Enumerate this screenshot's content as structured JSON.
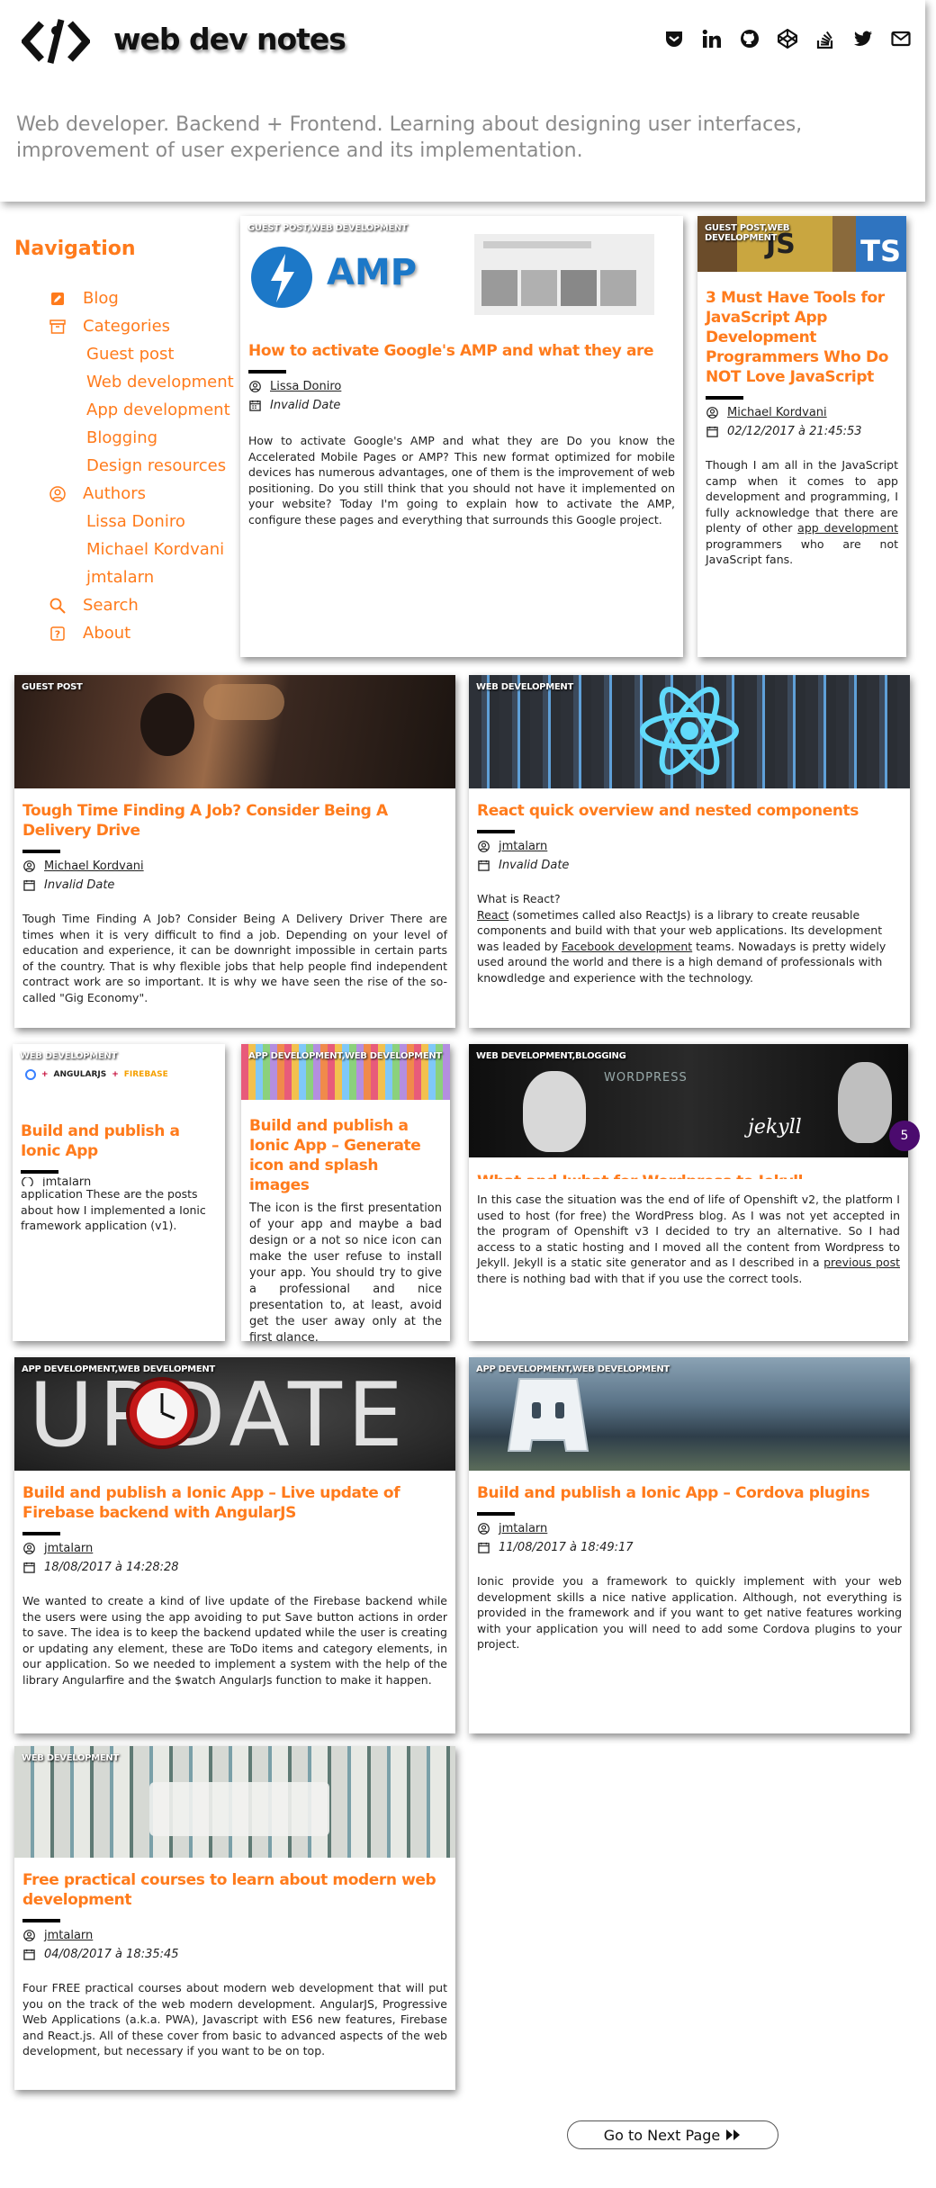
{
  "header": {
    "title": "web dev notes",
    "tagline": "Web developer. Backend + Frontend. Learning about designing user interfaces, improvement of user experience and its implementation.",
    "social": [
      "pocket-icon",
      "linkedin-icon",
      "github-icon",
      "codepen-icon",
      "stackoverflow-icon",
      "twitter-icon",
      "mail-icon"
    ]
  },
  "nav": {
    "title": "Navigation",
    "blog": "Blog",
    "categories": "Categories",
    "category_items": [
      "Guest post",
      "Web development",
      "App development",
      "Blogging",
      "Design resources"
    ],
    "authors": "Authors",
    "author_items": [
      "Lissa Doniro",
      "Michael Kordvani",
      "jmtalarn"
    ],
    "search": "Search",
    "about": "About"
  },
  "posts": [
    {
      "category": "GUEST POST,WEB DEVELOPMENT",
      "title": "How to activate Google's AMP and what they are",
      "author": "Lissa Doniro",
      "date": "Invalid Date",
      "excerpt": "How to activate Google's AMP and what they are Do you know the Accelerated Mobile Pages or AMP? This new format optimized for mobile devices has numerous advantages, one of them is the improvement of web positioning. Do you still think that you should not have it implemented on your website? Today I'm going to explain how to activate the AMP, configure these pages and everything that surrounds this Google project.",
      "thumb_text": "AMP"
    },
    {
      "category": "GUEST POST,WEB DEVELOPMENT",
      "title": "3 Must Have Tools for JavaScript App Development Programmers Who Do NOT Love JavaScript",
      "author": "Michael Kordvani",
      "date": "02/12/2017 à 21:45:53",
      "excerpt_a": "Though I am all in the JavaScript camp when it comes to app development and programming, I fully acknowledge that there are plenty of other ",
      "excerpt_link": "app development",
      "excerpt_b": " programmers who are not JavaScript fans.",
      "thumb_js": "JS",
      "thumb_ts": "TS"
    },
    {
      "category": "GUEST POST",
      "title": "Tough Time Finding A Job? Consider Being A Delivery Drive",
      "author": "Michael Kordvani",
      "date": "Invalid Date",
      "excerpt": "Tough Time Finding A Job? Consider Being A Delivery Driver There are times when it is very difficult to find a job. Depending on your level of education and experience, it can be downright impossible in certain parts of the country. That is why flexible jobs that help people find independent contract work are so important. It is why we have seen the rise of the so-called \"Gig Economy\"."
    },
    {
      "category": "WEB DEVELOPMENT",
      "title": "React quick overview and nested components",
      "author": "jmtalarn",
      "date": "Invalid Date",
      "excerpt_q": "What is React?",
      "excerpt_link1": "React",
      "excerpt_a": " (sometimes called also ReactJs) is a library to create reusable components and build with that your web applications. Its development was leaded by ",
      "excerpt_link2": "Facebook development",
      "excerpt_b": " teams. Nowadays is pretty widely used around the world and there is a high demand of professionals with knowdledge and experience with the technology."
    },
    {
      "category": "WEB DEVELOPMENT",
      "title": "Build and publish a Ionic App",
      "author": "jmtalarn",
      "excerpt": "application These are the posts about how I implemented a Ionic framework application (v1).",
      "thumb_labels": [
        "ANGULARJS",
        "FIREBASE"
      ]
    },
    {
      "category": "APP DEVELOPMENT,WEB DEVELOPMENT",
      "title": "Build and publish a Ionic App – Generate icon and splash images",
      "excerpt": "The icon is the first presentation of your app and maybe a bad design or a not so nice icon can make the user refuse to install your app. You should try to give a professional and nice presentation to, at least, avoid get the user away only at the first glance."
    },
    {
      "category": "WEB DEVELOPMENT,BLOGGING",
      "title": "What and Iwhat for Wordpress to Jekyll",
      "excerpt_a": "In this case the situation was the end of life of Openshift v2, the platform I used to host (for free) the WordPress blog. As I was not yet accepted in the program of Openshift v3 I decided to try an alternative. So I had access to a static hosting and I moved all the content from Wordpress to Jekyll. Jekyll is a static site generator and as I described in a ",
      "excerpt_link": "previous post",
      "excerpt_b": " there is nothing bad with that if you use the correct tools.",
      "thumb_wp": "WORDPRESS",
      "thumb_jekyll": "jekyll"
    },
    {
      "category": "APP DEVELOPMENT,WEB DEVELOPMENT",
      "title": "Build and publish a Ionic App – Live update of Firebase backend with AngularJS",
      "author": "jmtalarn",
      "date": "18/08/2017 à 14:28:28",
      "excerpt": "We wanted to create a kind of live update of the Firebase backend while the users were using the app avoiding to put Save button actions in order to save. The idea is to keep the backend updated while the user is creating or updating any element, these are ToDo items and category elements, in our application. So we needed to implement a system with the help of the library Angularfire and the $watch AngularJs function to make it happen.",
      "thumb_text": "UPDATE"
    },
    {
      "category": "APP DEVELOPMENT,WEB DEVELOPMENT",
      "title": "Build and publish a Ionic App – Cordova plugins",
      "author": "jmtalarn",
      "date": "11/08/2017 à 18:49:17",
      "excerpt": "Ionic provide you a framework to quickly implement with your web development skills a nice native application. Although, not everything is provided in the framework and if you want to get native features working with your application you will need to add some Cordova plugins to your project."
    },
    {
      "category": "WEB DEVELOPMENT",
      "title": "Free practical courses to learn about modern web development",
      "author": "jmtalarn",
      "date": "04/08/2017 à 18:35:45",
      "excerpt": "Four FREE practical courses about modern web development that will put you on the track of the web modern development. AngularJS, Progressive Web Applications (a.k.a. PWA), Javascript with ES6 new features, Firebase and React.js. All of these cover from basic to advanced aspects of the web development, but necessary if you want to be on top."
    }
  ],
  "scroll_badge": "5",
  "pagination": {
    "next_label": "Go to Next Page"
  },
  "colors": {
    "accent": "#ff7b1c",
    "badge": "#4b0b6e"
  }
}
